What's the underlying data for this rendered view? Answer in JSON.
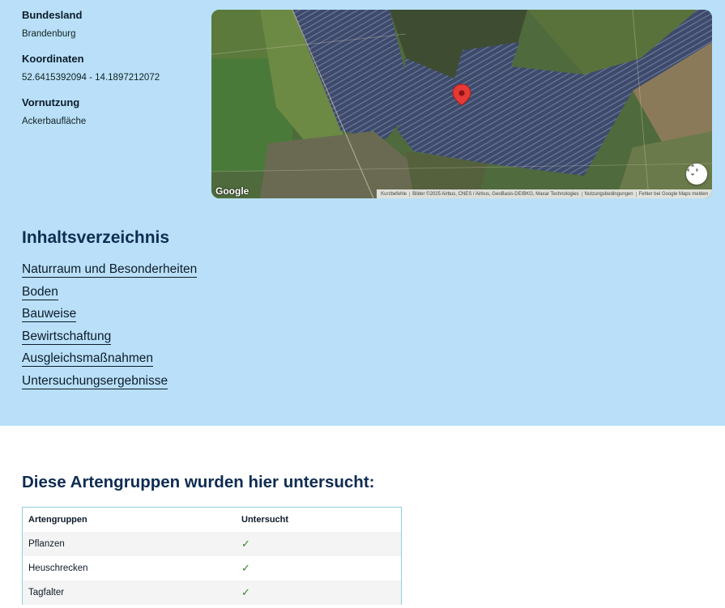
{
  "info": {
    "state_label": "Bundesland",
    "state_value": "Brandenburg",
    "coords_label": "Koordinaten",
    "coords_value": "52.6415392094 - 14.1897212072",
    "prior_use_label": "Vornutzung",
    "prior_use_value": "Ackerbaufläche"
  },
  "map": {
    "logo": "Google",
    "attribution": [
      "Kurzbefehle",
      "Bilder ©2025 Airbus, CNES / Airbus, GeoBasis-DE/BKG, Maxar Technologies",
      "Nutzungsbedingungen",
      "Fehler bei Google Maps melden"
    ],
    "marker_icon": "map-pin-icon",
    "fullscreen_icon": "fullscreen-icon",
    "marker_color": "#e53935"
  },
  "toc": {
    "title": "Inhaltsverzeichnis",
    "items": [
      "Naturraum und Besonderheiten",
      "Boden",
      "Bauweise",
      "Bewirtschaftung",
      "Ausgleichsmaßnahmen",
      "Untersuchungsergebnisse"
    ]
  },
  "species": {
    "title": "Diese Artengruppen wurden hier untersucht:",
    "headers": [
      "Artengruppen",
      "Untersucht"
    ],
    "rows": [
      {
        "group": "Pflanzen",
        "examined": "✓"
      },
      {
        "group": "Heuschrecken",
        "examined": "✓"
      },
      {
        "group": "Tagfalter",
        "examined": "✓"
      }
    ]
  },
  "colors": {
    "top_background": "#b9e0f8",
    "heading": "#0f2c52",
    "check": "#2a8a1f"
  }
}
